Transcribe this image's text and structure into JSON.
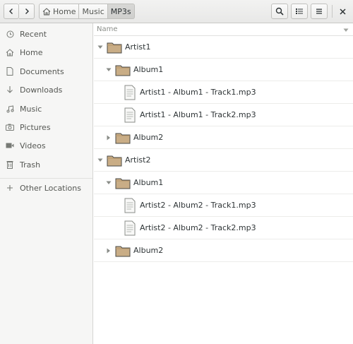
{
  "window": {
    "nav": {
      "back_icon": "chevron-left-icon",
      "forward_icon": "chevron-right-icon"
    },
    "pathbar": [
      {
        "label": "Home",
        "icon": "home-icon",
        "active": false
      },
      {
        "label": "Music",
        "active": false
      },
      {
        "label": "MP3s",
        "active": true
      }
    ],
    "actions": {
      "search_icon": "search-icon",
      "view_icon": "list-view-icon",
      "menu_icon": "hamburger-menu-icon",
      "close_icon": "close-icon"
    }
  },
  "sidebar": {
    "items": [
      {
        "label": "Recent",
        "icon": "clock-icon"
      },
      {
        "label": "Home",
        "icon": "home-icon"
      },
      {
        "label": "Documents",
        "icon": "document-icon"
      },
      {
        "label": "Downloads",
        "icon": "download-icon"
      },
      {
        "label": "Music",
        "icon": "music-icon"
      },
      {
        "label": "Pictures",
        "icon": "camera-icon"
      },
      {
        "label": "Videos",
        "icon": "video-icon"
      },
      {
        "label": "Trash",
        "icon": "trash-icon"
      }
    ],
    "other": {
      "label": "Other Locations",
      "icon": "plus-icon"
    }
  },
  "filelist": {
    "column_name": "Name",
    "rows": [
      {
        "label": "Artist1",
        "type": "folder",
        "level": 0,
        "expanded": true
      },
      {
        "label": "Album1",
        "type": "folder",
        "level": 1,
        "expanded": true
      },
      {
        "label": "Artist1 - Album1 - Track1.mp3",
        "type": "file",
        "level": 2
      },
      {
        "label": "Artist1 - Album1 - Track2.mp3",
        "type": "file",
        "level": 2
      },
      {
        "label": "Album2",
        "type": "folder",
        "level": 1,
        "expanded": false
      },
      {
        "label": "Artist2",
        "type": "folder",
        "level": 0,
        "expanded": true
      },
      {
        "label": "Album1",
        "type": "folder",
        "level": 1,
        "expanded": true
      },
      {
        "label": "Artist2 - Album2 - Track1.mp3",
        "type": "file",
        "level": 2
      },
      {
        "label": "Artist2 - Album2 - Track2.mp3",
        "type": "file",
        "level": 2
      },
      {
        "label": "Album2",
        "type": "folder",
        "level": 1,
        "expanded": false
      }
    ]
  },
  "colors": {
    "folder_fill": "#c9ad86",
    "folder_tab": "#b8966a",
    "folder_outline": "#4a4a46"
  }
}
